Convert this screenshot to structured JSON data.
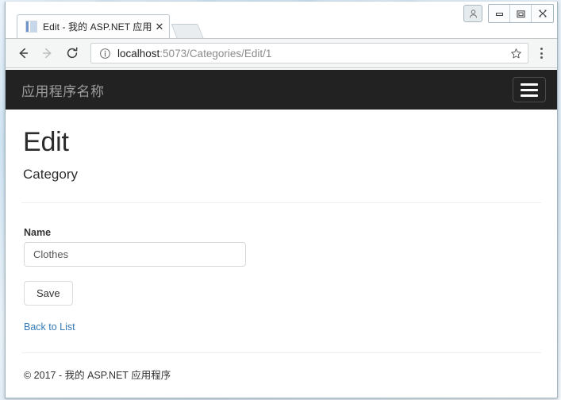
{
  "browser": {
    "tab": {
      "title": "Edit - 我的 ASP.NET 应用",
      "close_label": "✕",
      "favicon_name": "site-favicon"
    },
    "toolbar": {
      "back_label": "←",
      "forward_label": "→",
      "reload_label": "⟳",
      "info_label": "ⓘ",
      "url_host": "localhost",
      "url_path": ":5073/Categories/Edit/1",
      "url_full": "localhost:5073/Categories/Edit/1",
      "bookmark_label": "☆",
      "menu_label": "⋮"
    },
    "window_controls": {
      "profile_label": "◕",
      "minimize_label": "—",
      "maximize_label": "❐",
      "close_label": "✕"
    }
  },
  "page": {
    "navbar": {
      "brand": "应用程序名称",
      "toggle_name": "hamburger-icon"
    },
    "heading": "Edit",
    "subheading": "Category",
    "form": {
      "name_label": "Name",
      "name_value": "Clothes",
      "name_placeholder": "",
      "save_label": "Save"
    },
    "back_link": "Back to List",
    "footer": "© 2017 - 我的 ASP.NET 应用程序"
  },
  "colors": {
    "navbar_bg": "#222222",
    "brand_text": "#9d9d9d",
    "link": "#337ab7",
    "divider": "#eeeeee"
  }
}
